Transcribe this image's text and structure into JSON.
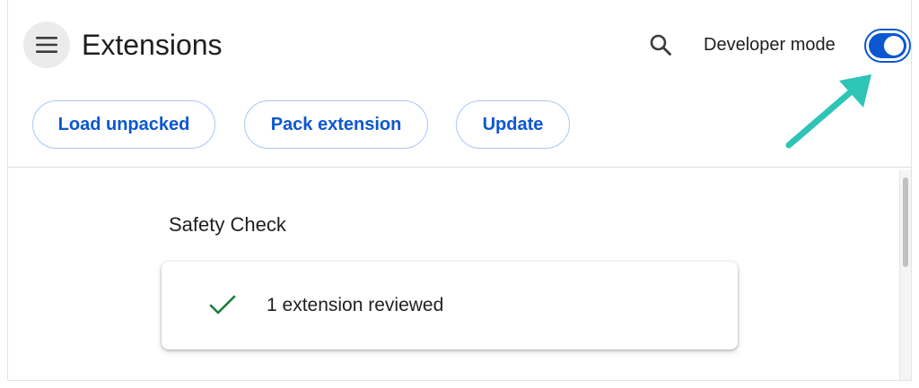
{
  "header": {
    "menu_icon": "hamburger-menu-icon",
    "title": "Extensions",
    "search_icon": "search-icon",
    "developer_mode_label": "Developer mode",
    "developer_mode_enabled": true
  },
  "toolbar": {
    "load_unpacked_label": "Load unpacked",
    "pack_extension_label": "Pack extension",
    "update_label": "Update"
  },
  "annotation": {
    "arrow_icon": "pointer-arrow-icon",
    "arrow_color": "#2ec4b6"
  },
  "safety_check": {
    "title": "Safety Check",
    "status_icon": "checkmark-icon",
    "status_text": "1 extension reviewed",
    "status_color": "#188038"
  },
  "colors": {
    "accent": "#0b57d0",
    "pill_border": "#a8c7fa",
    "text": "#1f1f1f"
  }
}
